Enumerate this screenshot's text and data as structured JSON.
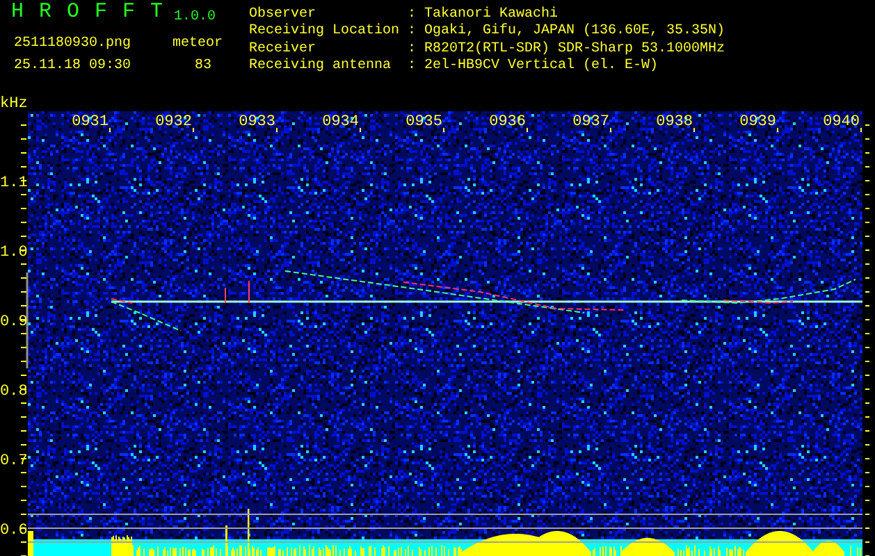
{
  "app": {
    "name": "H R O F F T",
    "version": "1.0.0"
  },
  "file": {
    "name": "2511180930.png",
    "datetime": "25.11.18 09:30"
  },
  "count": {
    "label": "meteor",
    "value": "83"
  },
  "info": [
    {
      "label": "Observer",
      "value": ": Takanori Kawachi"
    },
    {
      "label": "Receiving Location",
      "value": ": Ogaki, Gifu, JAPAN (136.60E, 35.35N)"
    },
    {
      "label": "Receiver",
      "value": ": R820T2(RTL-SDR) SDR-Sharp 53.1000MHz"
    },
    {
      "label": "Receiving antenna",
      "value": ": 2el-HB9CV Vertical (el. E-W)"
    }
  ],
  "plot": {
    "unit": "kHz",
    "y_labels": [
      "1.1",
      "1.0",
      "0.9",
      "0.8",
      "0.7",
      "0.6"
    ],
    "time_labels": [
      "0931",
      "0932",
      "0933",
      "0934",
      "0935",
      "0936",
      "0937",
      "0938",
      "0939",
      "0940"
    ]
  }
}
